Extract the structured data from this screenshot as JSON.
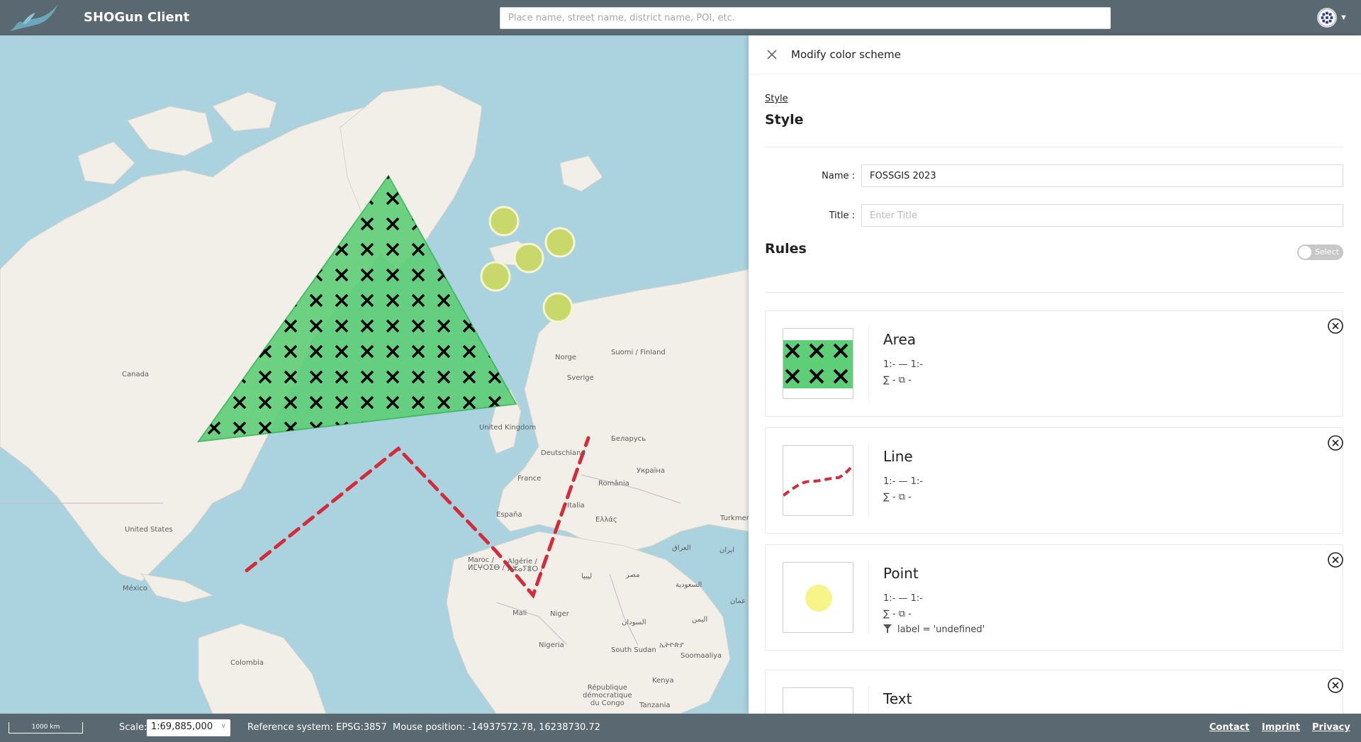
{
  "header": {
    "app_title": "SHOGun Client",
    "search_placeholder": "Place name, street name, district name, POI, etc."
  },
  "map": {
    "labels": {
      "canada": "Canada",
      "united_states": "United States",
      "mexico": "México",
      "colombia": "Colombia",
      "norge": "Norge",
      "suomi": "Suomi /\nFinland",
      "sverige": "Sverige",
      "uk": "United Kingdom",
      "deutschland": "Deutschland",
      "belarus": "Беларусь",
      "ukraina": "Україна",
      "france": "France",
      "romania": "România",
      "italia": "Italia",
      "espana": "España",
      "ellas": "Ελλάς",
      "turkmen": "Turkmen",
      "iraq": "العراق",
      "iran": "ایران",
      "maroc": "Maroc /\nⵍⵎⵖⵔⵉⴱ /",
      "algerie": "Algérie /\nⴷⵣⴰⵢⴻⵔ /",
      "libya": "ليبيا",
      "egypt": "مصر",
      "saudi": "السعودية",
      "mali": "Mali",
      "niger": "Niger",
      "sudan": "السودان",
      "yemen": "اليمن",
      "nigeria": "Nigeria",
      "south_sudan": "South Sudan",
      "ethiopia": "ኢትዮጵያ",
      "somalia": "Soomaaliya",
      "kenya": "Kenya",
      "drc": "République\ndémocratique\ndu Congo",
      "tanzania": "Tanzania",
      "oman": "عمان"
    },
    "features": {
      "area_fill": "#2ecc55",
      "line_color": "#d42b3a",
      "point_color": "#c8d86a"
    }
  },
  "panel": {
    "title": "Modify color scheme",
    "breadcrumb": "Style",
    "style_heading": "Style",
    "name_label": "Name",
    "name_value": "FOSSGIS 2023",
    "title_label": "Title",
    "title_placeholder": "Enter Title",
    "rules_heading": "Rules",
    "select_toggle_label": "Select",
    "rules": [
      {
        "name": "Area",
        "scale": "1:- — 1:-",
        "stats": "∑ -   ⧉ -",
        "filter": ""
      },
      {
        "name": "Line",
        "scale": "1:- — 1:-",
        "stats": "∑ -   ⧉ -",
        "filter": ""
      },
      {
        "name": "Point",
        "scale": "1:- — 1:-",
        "stats": "∑ -   ⧉ -",
        "filter": "label = 'undefined'"
      },
      {
        "name": "Text",
        "scale": "",
        "stats": "",
        "filter": ""
      }
    ]
  },
  "footer": {
    "scale_bar": "1000 km",
    "scale_label": "Scale:",
    "scale_value": "1:69,885,000",
    "reference_system": "Reference system: EPSG:3857",
    "mouse_position": "Mouse position: -14937572.78, 16238730.72",
    "links": [
      "Contact",
      "Imprint",
      "Privacy"
    ]
  }
}
